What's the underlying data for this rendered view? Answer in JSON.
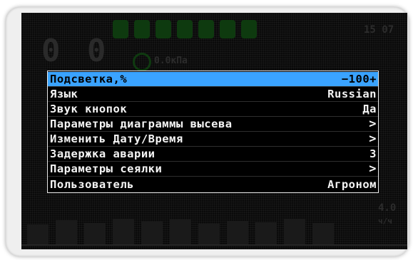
{
  "background": {
    "time": "15 07",
    "pressure": "0.0кПа",
    "speed_value": "4.0",
    "speed_unit": "ч/ч"
  },
  "menu": {
    "items": [
      {
        "label": "Подсветка,%",
        "value": "−100+",
        "selected": true
      },
      {
        "label": "Язык",
        "value": "Russian"
      },
      {
        "label": "Звук кнопок",
        "value": "Да"
      },
      {
        "label": "Параметры диаграммы высева",
        "value": ">"
      },
      {
        "label": "Изменить Дату/Время",
        "value": ">"
      },
      {
        "label": "Задержка аварии",
        "value": "3"
      },
      {
        "label": "Параметры сеялки",
        "value": ">"
      },
      {
        "label": "Пользователь",
        "value": "Агроном"
      }
    ]
  },
  "colors": {
    "selection": "#3aa3ff",
    "screen_bg": "#0a0a0a",
    "text": "#f4f4f4"
  }
}
